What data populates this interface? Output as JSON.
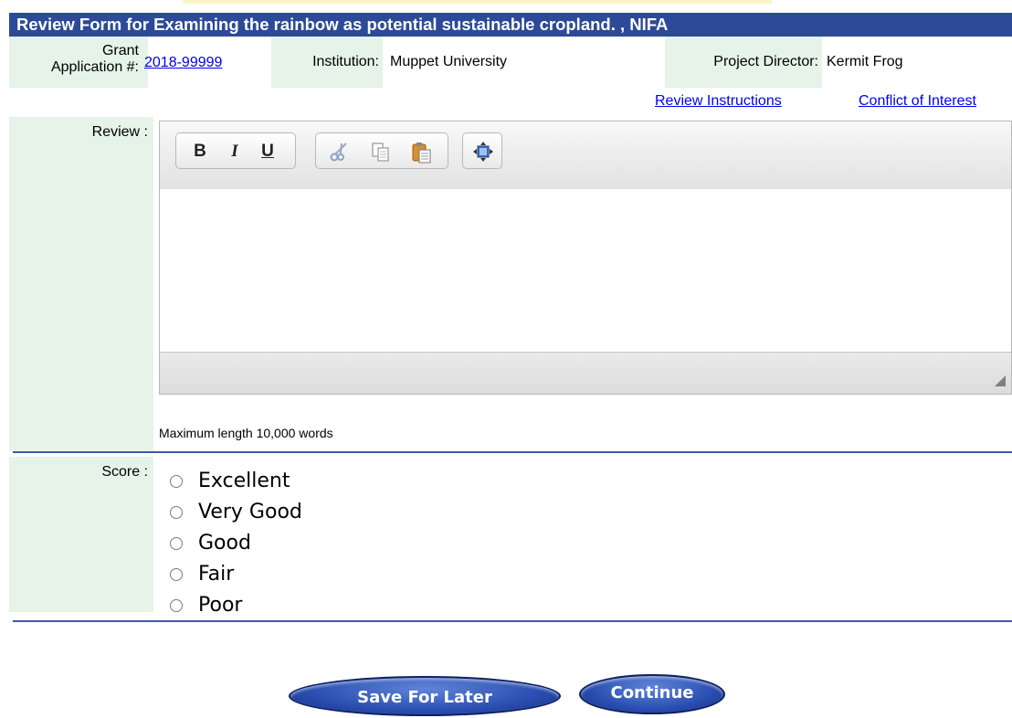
{
  "title": "Review Form for Examining the rainbow as potential sustainable cropland. , NIFA",
  "header": {
    "grant_label_1": "Grant",
    "grant_label_2": "Application #:",
    "grant_number": "2018-99999",
    "institution_label": "Institution:",
    "institution_value": "Muppet University",
    "director_label": "Project Director:",
    "director_value": "Kermit Frog"
  },
  "links": {
    "review_instructions": "Review Instructions",
    "conflict_of_interest": "Conflict of Interest"
  },
  "review": {
    "label": "Review :",
    "toolbar": {
      "bold": "B",
      "italic": "I",
      "underline": "U",
      "icons": [
        "cut-icon",
        "copy-icon",
        "paste-icon",
        "maximize-icon"
      ]
    },
    "text": "",
    "max_length_note": "Maximum length 10,000 words"
  },
  "score": {
    "label": "Score :",
    "options": [
      "Excellent",
      "Very Good",
      "Good",
      "Fair",
      "Poor"
    ]
  },
  "buttons": {
    "save": "Save For Later",
    "continue": "Continue"
  },
  "colors": {
    "title_bar": "#2c4a97",
    "label_bg": "#e6f3e8",
    "link": "#0000ee",
    "rule": "#3b5aa8"
  }
}
